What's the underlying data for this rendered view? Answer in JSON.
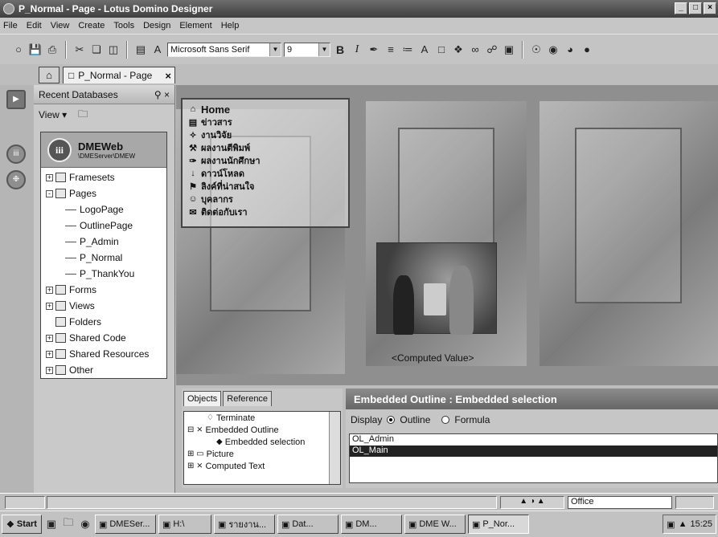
{
  "window": {
    "title": "P_Normal - Page - Lotus Domino Designer",
    "min": "_",
    "max": "□",
    "close": "×"
  },
  "menu": [
    "File",
    "Edit",
    "View",
    "Create",
    "Tools",
    "Design",
    "Element",
    "Help"
  ],
  "toolbar": {
    "font_name": "Microsoft Sans Serif",
    "font_size": "9",
    "bold": "B",
    "italic": "I"
  },
  "tabs": {
    "page_tab": "P_Normal - Page",
    "close": "×"
  },
  "bookmarks": {
    "header": "Recent Databases",
    "view_label": "View ▾",
    "database": {
      "logo": "iii",
      "name": "DMEWeb",
      "server": "\\DMEServer\\DMEW"
    },
    "tree": [
      {
        "label": "Framesets",
        "level": 0,
        "exp": "+"
      },
      {
        "label": "Pages",
        "level": 0,
        "exp": "-"
      },
      {
        "label": "LogoPage",
        "level": 1
      },
      {
        "label": "OutlinePage",
        "level": 1
      },
      {
        "label": "P_Admin",
        "level": 1
      },
      {
        "label": "P_Normal",
        "level": 1
      },
      {
        "label": "P_ThankYou",
        "level": 1
      },
      {
        "label": "Forms",
        "level": 0,
        "exp": "+"
      },
      {
        "label": "Views",
        "level": 0,
        "exp": "+"
      },
      {
        "label": "Folders",
        "level": 0
      },
      {
        "label": "Shared Code",
        "level": 0,
        "exp": "+"
      },
      {
        "label": "Shared Resources",
        "level": 0,
        "exp": "+"
      },
      {
        "label": "Other",
        "level": 0,
        "exp": "+"
      }
    ]
  },
  "canvas": {
    "nav": [
      {
        "icon": "⌂",
        "label": "Home"
      },
      {
        "icon": "▤",
        "label": "ข่าวสาร"
      },
      {
        "icon": "✧",
        "label": "งานวิจัย"
      },
      {
        "icon": "⚒",
        "label": "ผลงานตีพิมพ์"
      },
      {
        "icon": "✑",
        "label": "ผลงานนักศึกษา"
      },
      {
        "icon": "↓",
        "label": "ดาวน์โหลด"
      },
      {
        "icon": "⚑",
        "label": "ลิงค์ที่น่าสนใจ"
      },
      {
        "icon": "☺",
        "label": "บุคลากร"
      },
      {
        "icon": "✉",
        "label": "ติดต่อกับเรา"
      }
    ],
    "computed_value": "<Computed Value>"
  },
  "objects": {
    "tab_objects": "Objects",
    "tab_reference": "Reference",
    "items": [
      {
        "glyph": "♢",
        "label": "Terminate",
        "indent": 2
      },
      {
        "glyph": "⊟ ⨯",
        "label": "Embedded Outline",
        "indent": 0
      },
      {
        "glyph": "◆",
        "label": "Embedded selection",
        "indent": 3
      },
      {
        "glyph": "⊞ ▭",
        "label": "Picture",
        "indent": 0
      },
      {
        "glyph": "⊞ ⨯",
        "label": "Computed Text",
        "indent": 0
      }
    ]
  },
  "properties": {
    "header": "Embedded Outline : Embedded selection",
    "display_label": "Display",
    "opt_outline": "Outline",
    "opt_formula": "Formula",
    "outlines": [
      {
        "label": "OL_Admin",
        "selected": false
      },
      {
        "label": "OL_Main",
        "selected": true
      }
    ]
  },
  "status": {
    "office": "Office"
  },
  "taskbar": {
    "start": "Start",
    "buttons": [
      {
        "label": "DMESer...",
        "active": false
      },
      {
        "label": "H:\\",
        "active": false
      },
      {
        "label": "รายงาน...",
        "active": false
      },
      {
        "label": "Dat...",
        "active": false
      },
      {
        "label": "DM...",
        "active": false
      },
      {
        "label": "DME W...",
        "active": false
      },
      {
        "label": "P_Nor...",
        "active": true
      }
    ],
    "clock": "15:25"
  }
}
